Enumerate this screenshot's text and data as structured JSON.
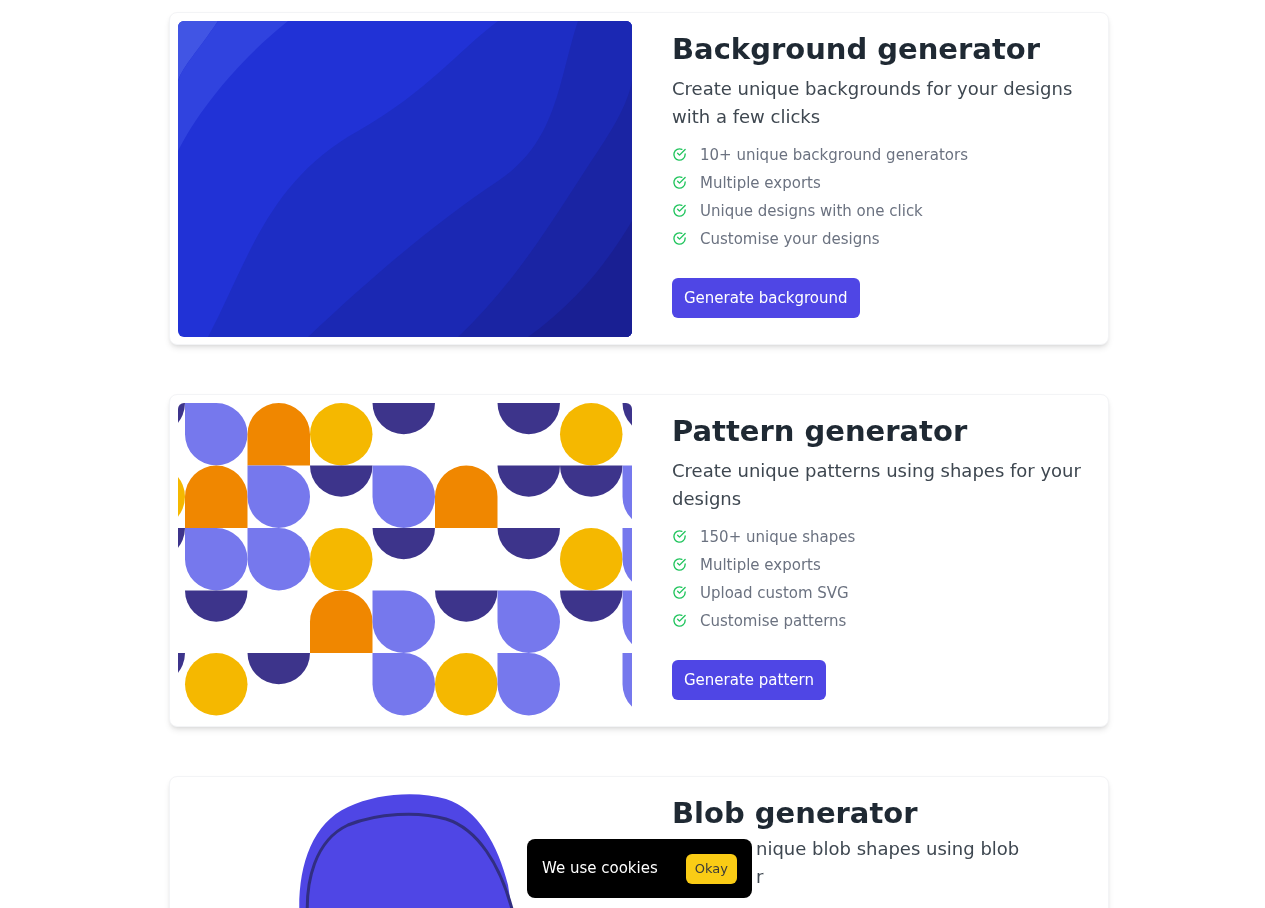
{
  "cards": [
    {
      "kind": "background",
      "title": "Background generator",
      "subtitle": "Create unique backgrounds for your designs with a few clicks",
      "features": [
        "10+ unique background generators",
        "Multiple exports",
        "Unique designs with one click",
        "Customise your designs"
      ],
      "button": "Generate background"
    },
    {
      "kind": "pattern",
      "title": "Pattern generator",
      "subtitle": "Create unique patterns using shapes for your designs",
      "features": [
        "150+ unique shapes",
        "Multiple exports",
        "Upload custom SVG",
        "Customise patterns"
      ],
      "button": "Generate pattern"
    },
    {
      "kind": "blob",
      "title": "Blob generator",
      "subtitle_fragments": [
        "nique blob shapes using blob",
        "r"
      ]
    }
  ],
  "cookie_banner": {
    "text": "We use cookies",
    "button": "Okay"
  }
}
